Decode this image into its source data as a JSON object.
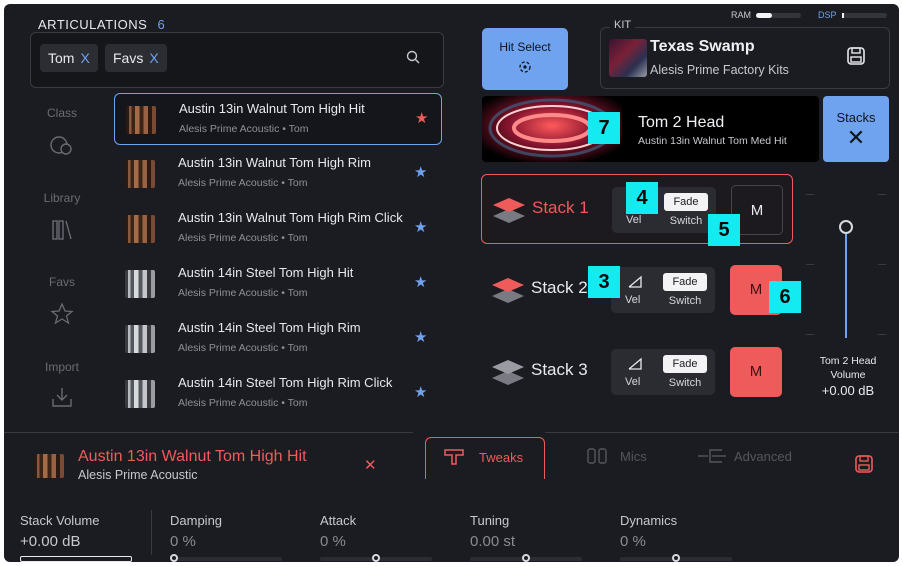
{
  "status": {
    "ram_label": "RAM",
    "dsp_label": "DSP"
  },
  "articulations": {
    "title": "ARTICULATIONS",
    "count": "6"
  },
  "filters": [
    {
      "label": "Tom"
    },
    {
      "label": "Favs"
    }
  ],
  "filter_remove_glyph": "X",
  "nav": [
    {
      "label": "Class",
      "icon": "class-icon"
    },
    {
      "label": "Library",
      "icon": "library-icon"
    },
    {
      "label": "Favs",
      "icon": "star-outline-icon"
    },
    {
      "label": "Import",
      "icon": "import-icon"
    }
  ],
  "list": [
    {
      "title": "Austin 13in Walnut Tom High Hit",
      "subtitle": "Alesis Prime Acoustic • Tom",
      "selected": true,
      "drum": "walnut"
    },
    {
      "title": "Austin 13in Walnut Tom High Rim",
      "subtitle": "Alesis Prime Acoustic • Tom",
      "drum": "walnut"
    },
    {
      "title": "Austin 13in Walnut Tom High Rim Click",
      "subtitle": "Alesis Prime Acoustic • Tom",
      "drum": "walnut"
    },
    {
      "title": "Austin 14in Steel Tom High Hit",
      "subtitle": "Alesis Prime Acoustic • Tom",
      "drum": "steel"
    },
    {
      "title": "Austin 14in Steel Tom High Rim",
      "subtitle": "Alesis Prime Acoustic • Tom",
      "drum": "steel"
    },
    {
      "title": "Austin 14in Steel Tom High Rim Click",
      "subtitle": "Alesis Prime Acoustic • Tom",
      "drum": "steel"
    }
  ],
  "hit_select": {
    "label": "Hit Select"
  },
  "kit": {
    "section_label": "KIT",
    "name": "Texas Swamp",
    "subtitle": "Alesis Prime Factory Kits"
  },
  "head": {
    "title": "Tom 2 Head",
    "subtitle": "Austin 13in Walnut Tom Med Hit"
  },
  "stacks_button": {
    "label": "Stacks",
    "glyph": "✕"
  },
  "stacks": [
    {
      "name": "Stack 1",
      "fade": "Fade",
      "switch": "Switch",
      "vel": "Vel",
      "mute": "M",
      "active": true,
      "muted": false
    },
    {
      "name": "Stack 2",
      "fade": "Fade",
      "switch": "Switch",
      "vel": "Vel",
      "mute": "M",
      "active": false,
      "muted": true
    },
    {
      "name": "Stack 3",
      "fade": "Fade",
      "switch": "Switch",
      "vel": "Vel",
      "mute": "M",
      "active": false,
      "muted": true
    }
  ],
  "volume": {
    "label_line1": "Tom 2 Head",
    "label_line2": "Volume",
    "value": "+0.00 dB"
  },
  "badges": [
    "7",
    "4",
    "5",
    "3",
    "6"
  ],
  "footer": {
    "title": "Austin 13in Walnut Tom High Hit",
    "subtitle": "Alesis Prime Acoustic",
    "close_glyph": "✕"
  },
  "tabs": [
    {
      "label": "Tweaks",
      "icon": "tweaks-icon",
      "active": true
    },
    {
      "label": "Mics",
      "icon": "mics-icon",
      "active": false
    },
    {
      "label": "Advanced",
      "icon": "advanced-icon",
      "active": false
    }
  ],
  "params": [
    {
      "label": "Stack Volume",
      "value": "+0.00 dB",
      "fill": 1.0
    },
    {
      "label": "Damping",
      "value": "0 %",
      "fill": 0.0
    },
    {
      "label": "Attack",
      "value": "0 %",
      "fill": 0.5
    },
    {
      "label": "Tuning",
      "value": "0.00 st",
      "fill": 0.5
    },
    {
      "label": "Dynamics",
      "value": "0 %",
      "fill": 0.5
    }
  ],
  "colors": {
    "accent_red": "#ef5b5b",
    "accent_blue": "#6fa3f0",
    "badge": "#13ebf0",
    "bg": "#1b1c21"
  }
}
